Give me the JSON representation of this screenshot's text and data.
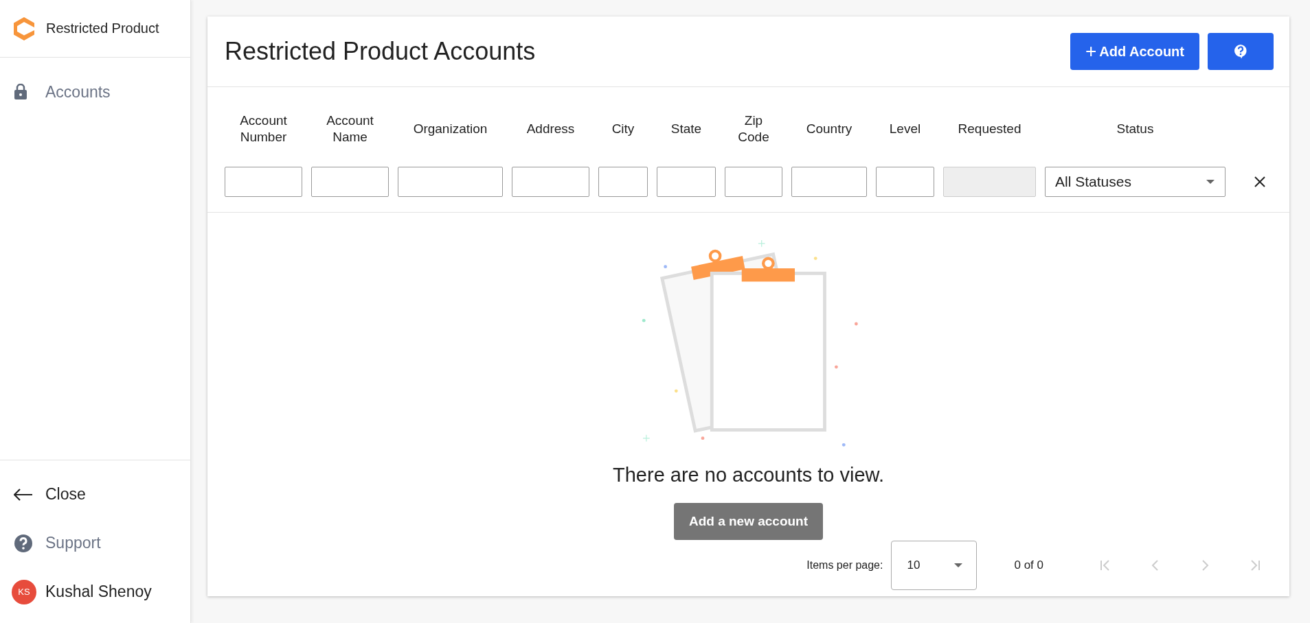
{
  "sidebar": {
    "brand": "Restricted Product",
    "nav": [
      {
        "kind": "lock",
        "label": "Accounts"
      }
    ],
    "footer": [
      {
        "kind": "back",
        "label": "Close"
      },
      {
        "kind": "help",
        "label": "Support"
      },
      {
        "kind": "user",
        "label": "Kushal Shenoy",
        "initials": "KS"
      }
    ]
  },
  "page": {
    "title": "Restricted Product Accounts",
    "add_button": "Add Account",
    "add_icon": "+"
  },
  "filters": [
    {
      "label": "Account Number",
      "kind": "text"
    },
    {
      "label": "Account Name",
      "kind": "text"
    },
    {
      "label": "Organization",
      "kind": "text"
    },
    {
      "label": "Address",
      "kind": "text"
    },
    {
      "label": "City",
      "kind": "text"
    },
    {
      "label": "State",
      "kind": "text"
    },
    {
      "label": "Zip Code",
      "kind": "text"
    },
    {
      "label": "Country",
      "kind": "text"
    },
    {
      "label": "Level",
      "kind": "text"
    },
    {
      "label": "Requested",
      "kind": "disabled"
    },
    {
      "label": "Status",
      "kind": "select",
      "value": "All Statuses"
    }
  ],
  "empty": {
    "message": "There are no accounts to view.",
    "button": "Add a new account"
  },
  "pagination": {
    "label": "Items per page:",
    "page_size": "10",
    "range": "0 of 0",
    "buttons": [
      {
        "kind": "first",
        "disabled": true
      },
      {
        "kind": "prev",
        "disabled": true
      },
      {
        "kind": "next",
        "disabled": true
      },
      {
        "kind": "last",
        "disabled": true
      }
    ]
  }
}
